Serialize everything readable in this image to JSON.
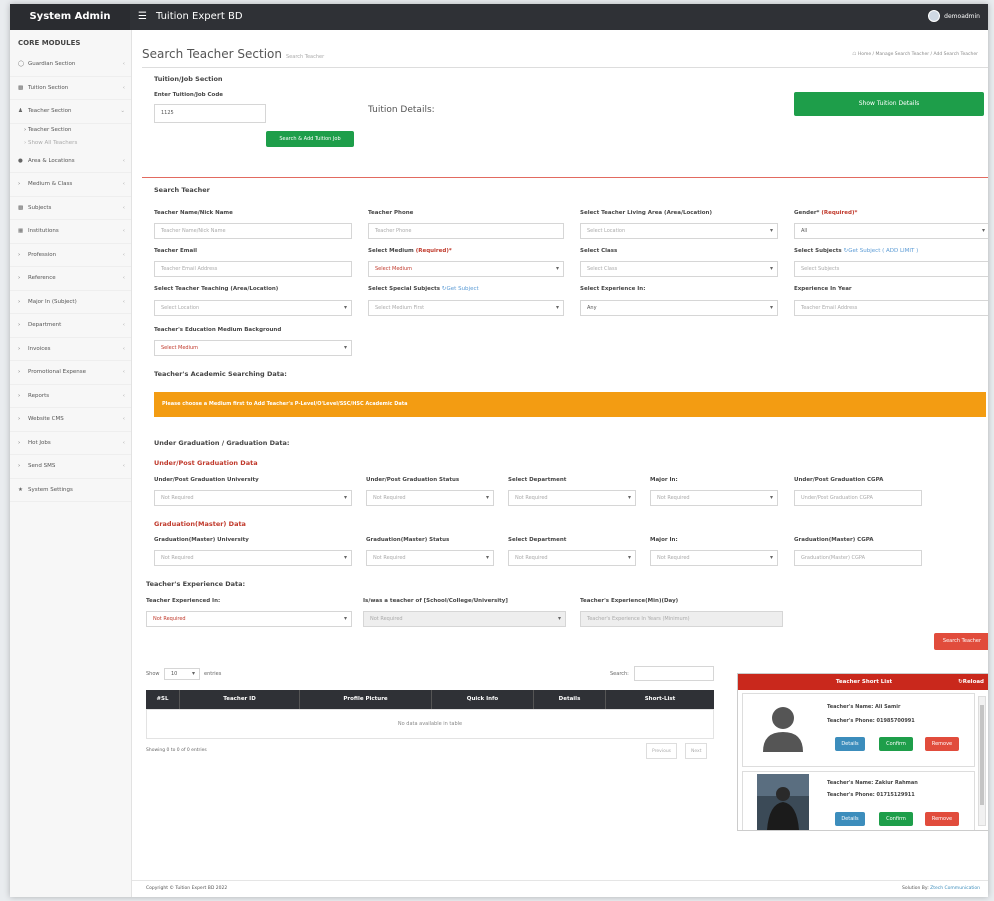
{
  "app": {
    "brand": "System Admin",
    "title": "Tuition Expert BD",
    "user": "demoadmin"
  },
  "sidebar": {
    "heading": "CORE MODULES",
    "items": [
      {
        "label": "Guardian Section",
        "icon": "user-circle-icon"
      },
      {
        "label": "Tuition Section",
        "icon": "book-icon"
      },
      {
        "label": "Teacher Section",
        "icon": "user-icon"
      },
      {
        "label": "Area & Locations",
        "icon": "map-marker-icon"
      },
      {
        "label": "Medium & Class",
        "icon": "caret-icon"
      },
      {
        "label": "Subjects",
        "icon": "book-icon"
      },
      {
        "label": "Institutions",
        "icon": "building-icon"
      },
      {
        "label": "Profession",
        "icon": "caret-icon"
      },
      {
        "label": "Reference",
        "icon": "caret-icon"
      },
      {
        "label": "Major In (Subject)",
        "icon": "caret-icon"
      },
      {
        "label": "Department",
        "icon": "caret-icon"
      },
      {
        "label": "Invoices",
        "icon": "caret-icon"
      },
      {
        "label": "Promotional Expense",
        "icon": "caret-icon"
      },
      {
        "label": "Reports",
        "icon": "caret-icon"
      },
      {
        "label": "Website CMS",
        "icon": "caret-icon"
      },
      {
        "label": "Hot Jobs",
        "icon": "caret-icon"
      },
      {
        "label": "Send SMS",
        "icon": "caret-icon"
      },
      {
        "label": "System Settings",
        "icon": "lock-icon"
      }
    ],
    "sub_items": [
      "Teacher Section",
      "Show All Teachers"
    ]
  },
  "page": {
    "title": "Search Teacher Section",
    "subtitle": "Search Teacher",
    "breadcrumb": "Home  /  Manage Search Teacher  /  Add Search Teacher"
  },
  "tuition": {
    "heading": "Tuition/Job Section",
    "code_label": "Enter Tuition/Job Code",
    "code_value": "1125",
    "search_add_btn": "Search & Add Tuition Job",
    "details_label": "Tuition Details:",
    "show_details_btn": "Show Tuition Details"
  },
  "search": {
    "heading": "Search Teacher",
    "name_label": "Teacher Name/Nick Name",
    "name_ph": "Teacher Name/Nick Name",
    "phone_label": "Teacher Phone",
    "phone_ph": "Teacher Phone",
    "living_label": "Select Teacher Living Area (Area/Location)",
    "living_val": "Select Location",
    "gender_label": "Gender*",
    "gender_req": "(Required)*",
    "gender_val": "All",
    "email_label": "Teacher Email",
    "email_ph": "Teacher Email Address",
    "medium_label": "Select Medium",
    "medium_req": "(Required)*",
    "medium_val": "Select Medium",
    "class_label": "Select Class",
    "class_val": "Select Class",
    "subjects_label": "Select Subjects",
    "subjects_link": "Get Subject ( ADD LIMIT )",
    "subjects_ph": "Select Subjects",
    "teaching_label": "Select Teacher Teaching (Area/Location)",
    "teaching_val": "Select Location",
    "special_label": "Select Special Subjects",
    "special_link": "Get Subject",
    "special_val": "Select Medium First",
    "exp_in_label": "Select Experience In:",
    "exp_in_val": "Any",
    "exp_year_label": "Experience In Year",
    "exp_year_ph": "Teacher Email Address",
    "edu_medium_label": "Teacher's Education Medium Background",
    "edu_medium_val": "Select Medium"
  },
  "academic": {
    "heading": "Teacher's Academic Searching Data:",
    "alert": "Please choose a Medium first to Add Teacher's P-Level/O'Level/SSC/HSC Academic Data"
  },
  "ugrad": {
    "heading": "Under Graduation / Graduation Data:",
    "sub_heading": "Under/Post Graduation Data",
    "university_label": "Under/Post Graduation University",
    "university_val": "Not Required",
    "status_label": "Under/Post Graduation Status",
    "status_val": "Not Required",
    "dept_label": "Select Department",
    "dept_val": "Not Required",
    "major_label": "Major In:",
    "major_val": "Not Required",
    "cgpa_label": "Under/Post Graduation CGPA",
    "cgpa_ph": "Under/Post Graduation CGPA"
  },
  "masters": {
    "sub_heading": "Graduation(Master) Data",
    "university_label": "Graduation(Master) University",
    "university_val": "Not Required",
    "status_label": "Graduation(Master) Status",
    "status_val": "Not Required",
    "dept_label": "Select Department",
    "dept_val": "Not Required",
    "major_label": "Major In:",
    "major_val": "Not Required",
    "cgpa_label": "Graduation(Master) CGPA",
    "cgpa_ph": "Graduation(Master) CGPA"
  },
  "experience": {
    "heading": "Teacher's Experience Data:",
    "exp_in_label": "Teacher Experienced In:",
    "exp_in_val": "Not Required",
    "teacher_of_label": "Is/was a teacher of [School/College/University]",
    "teacher_of_val": "Not Required",
    "years_label": "Teacher's Experience(Min)(Day)",
    "years_ph": "Teacher's Experience In Years (Minimum)"
  },
  "search_btn": "Search Teacher",
  "table": {
    "show_label": "Show",
    "entries_val": "10",
    "entries_label": "entries",
    "search_label": "Search:",
    "columns": [
      "#SL",
      "Teacher ID",
      "Profile Picture",
      "Quick Info",
      "Details",
      "Short-List"
    ],
    "empty": "No data available in table",
    "info": "Showing 0 to 0 of 0 entries",
    "prev": "Previous",
    "next": "Next"
  },
  "shortlist": {
    "title": "Teacher Short List",
    "reload": "Reload",
    "cards": [
      {
        "name": "Teacher's Name: Ali Samir",
        "phone": "Teacher's Phone: 01985700991"
      },
      {
        "name": "Teacher's Name: Zakiur Rahman",
        "phone": "Teacher's Phone: 01715129911"
      }
    ],
    "details_btn": "Details",
    "confirm_btn": "Confirm",
    "remove_btn": "Remove"
  },
  "footer": {
    "copyright": "Copyright © Tuition Expert BD 2022",
    "solution": "Solution By: ",
    "vendor": "Ztech Communication"
  }
}
